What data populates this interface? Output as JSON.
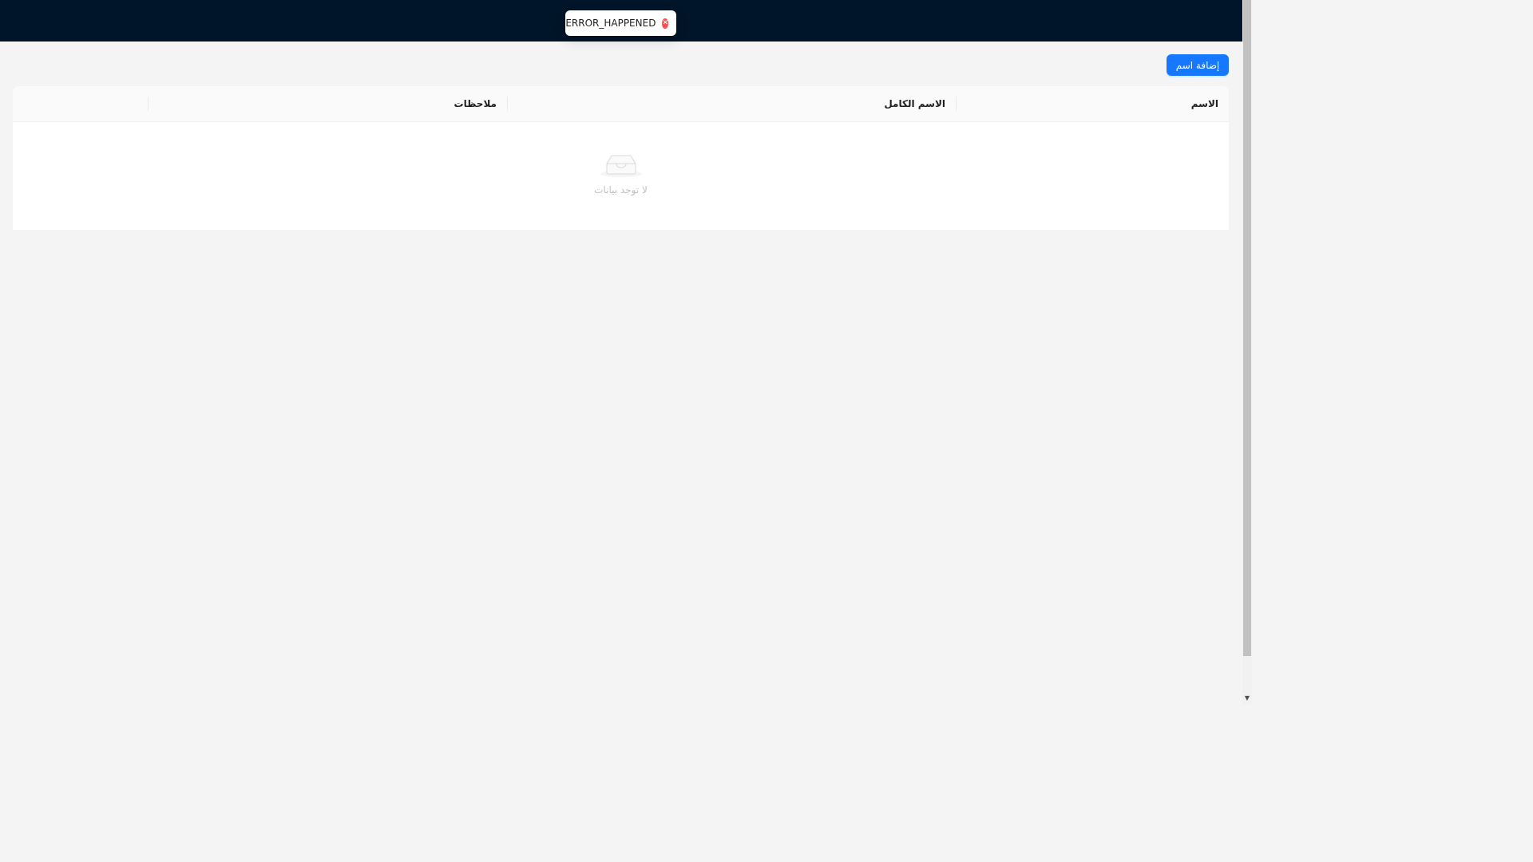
{
  "toast": {
    "message": "ERROR_HAPPENED",
    "icon": "close-circle-icon"
  },
  "toolbar": {
    "add_label": "إضافة اسم"
  },
  "table": {
    "columns": [
      "الاسم",
      "الاسم الكامل",
      "ملاحظات",
      ""
    ],
    "empty_text": "لا توجد بيانات"
  },
  "colors": {
    "header_bg": "#001529",
    "primary": "#1677ff",
    "error": "#ff4d4f",
    "page_bg": "#f4f4f4"
  }
}
